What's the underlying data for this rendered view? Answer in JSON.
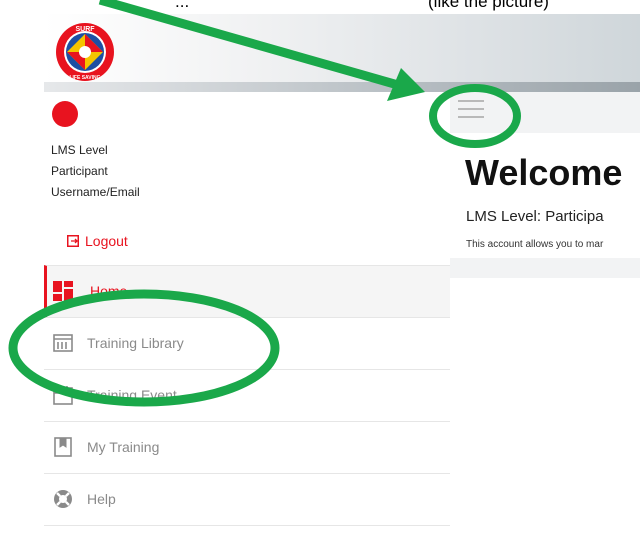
{
  "caption": {
    "left": "...",
    "right": "(like the picture)"
  },
  "header": {
    "logo_text_top": "SURF",
    "logo_text_bottom": "LIFE SAVING"
  },
  "user": {
    "lms_level": "LMS Level",
    "role": "Participant",
    "username": "Username/Email"
  },
  "logout": {
    "label": "Logout"
  },
  "nav": {
    "items": [
      {
        "label": "Home",
        "icon": "dashboard-icon",
        "active": true
      },
      {
        "label": "Training Library",
        "icon": "library-icon"
      },
      {
        "label": "Training Event",
        "icon": "calendar-icon"
      },
      {
        "label": "My Training",
        "icon": "bookmark-icon"
      },
      {
        "label": "Help",
        "icon": "lifebuoy-icon"
      }
    ]
  },
  "main": {
    "title": "Welcome",
    "lms_level_text": "LMS Level: Participa",
    "description": "This account allows you to mar"
  },
  "colors": {
    "accent": "#e8131f",
    "annotation": "#1aa84a",
    "muted": "#8a8a8a"
  }
}
